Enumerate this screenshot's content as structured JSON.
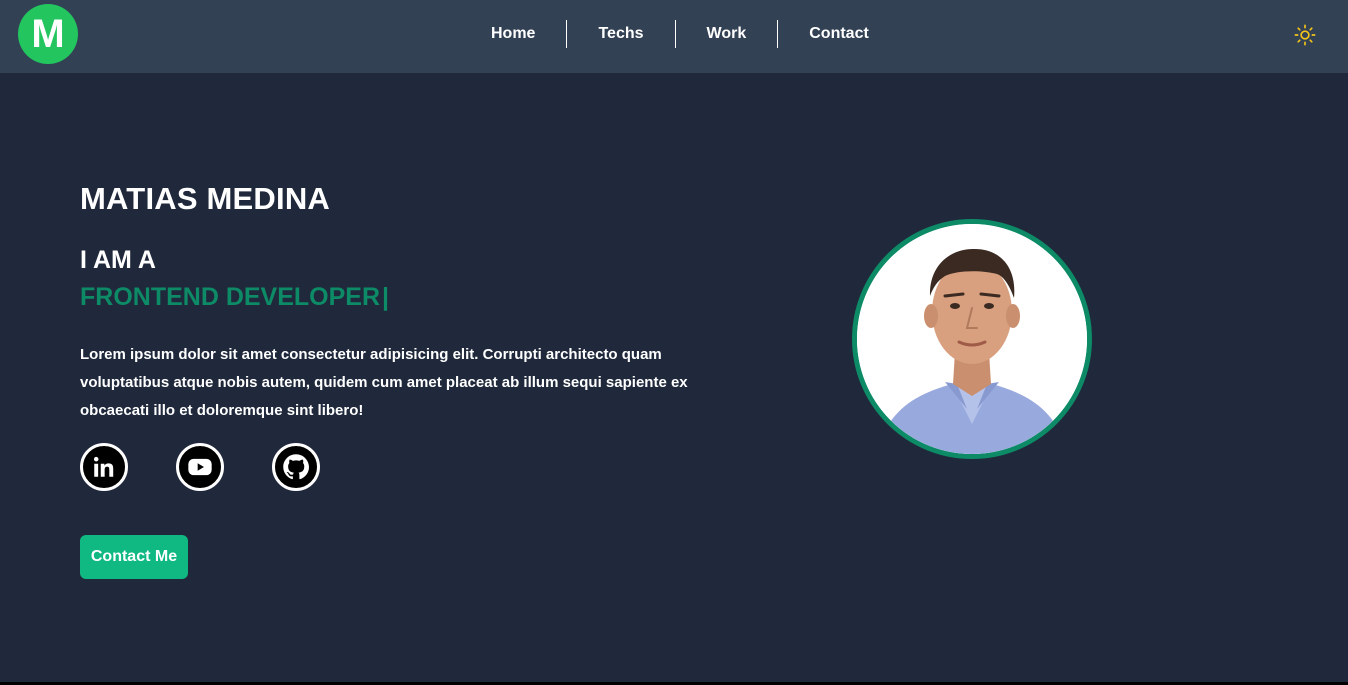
{
  "navbar": {
    "logo_letter": "M",
    "links": [
      "Home",
      "Techs",
      "Work",
      "Contact"
    ],
    "theme_icon": "sun-icon",
    "colors": {
      "background": "#334155",
      "logo": "#22c55e",
      "sun": "#f5c518"
    }
  },
  "hero": {
    "name": "MATIAS MEDINA",
    "intro": "I AM A",
    "role": "FRONTEND DEVELOPER",
    "typing_cursor": "|",
    "description": "Lorem ipsum dolor sit amet consectetur adipisicing elit. Corrupti architecto quam voluptatibus atque nobis autem, quidem cum amet placeat ab illum sequi sapiente ex obcaecati illo et doloremque sint libero!",
    "socials": [
      "linkedin-icon",
      "youtube-icon",
      "github-icon"
    ],
    "contact_button": "Contact Me",
    "colors": {
      "background": "#1f293b",
      "accent": "#0d8a66",
      "button": "#10b981"
    }
  },
  "profile": {
    "photo": "avatar-photo"
  }
}
